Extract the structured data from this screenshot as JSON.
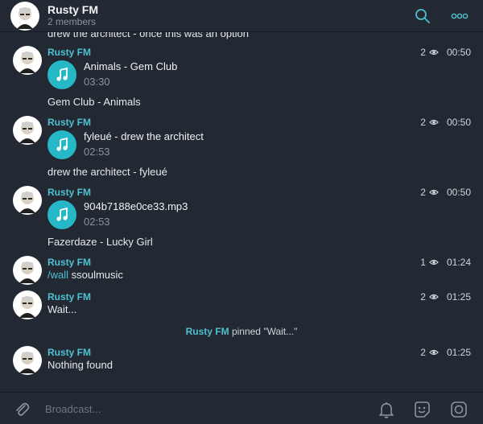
{
  "header": {
    "title": "Rusty FM",
    "subtitle": "2 members"
  },
  "colors": {
    "accent": "#4fc0d0",
    "play_button": "#26b8c7",
    "background": "#222933"
  },
  "messages": {
    "cut_text": "drew the architect - once this was an option",
    "m1": {
      "sender": "Rusty FM",
      "views": "2",
      "time": "00:50",
      "audio_title": "Animals - Gem Club",
      "audio_duration": "03:30",
      "caption": "Gem Club - Animals"
    },
    "m2": {
      "sender": "Rusty FM",
      "views": "2",
      "time": "00:50",
      "audio_title": "fyleué - drew the architect",
      "audio_duration": "02:53",
      "caption": "drew the architect - fyleué"
    },
    "m3": {
      "sender": "Rusty FM",
      "views": "2",
      "time": "00:50",
      "audio_title": "904b7188e0ce33.mp3",
      "audio_duration": "02:53",
      "caption": "Fazerdaze - Lucky Girl"
    },
    "m4": {
      "sender": "Rusty FM",
      "views": "1",
      "time": "01:24",
      "command": "/wall",
      "text": " ssoulmusic"
    },
    "m5": {
      "sender": "Rusty FM",
      "views": "2",
      "time": "01:25",
      "text": "Wait..."
    },
    "service": {
      "who": "Rusty FM",
      "action": " pinned \"Wait...\""
    },
    "m6": {
      "sender": "Rusty FM",
      "views": "2",
      "time": "01:25",
      "text": "Nothing found"
    }
  },
  "composer": {
    "placeholder": "Broadcast..."
  },
  "icons": [
    "search-icon",
    "more-icon",
    "play-icon",
    "eye-icon",
    "paperclip-icon",
    "bell-icon",
    "emoji-icon",
    "bot-command-icon"
  ]
}
